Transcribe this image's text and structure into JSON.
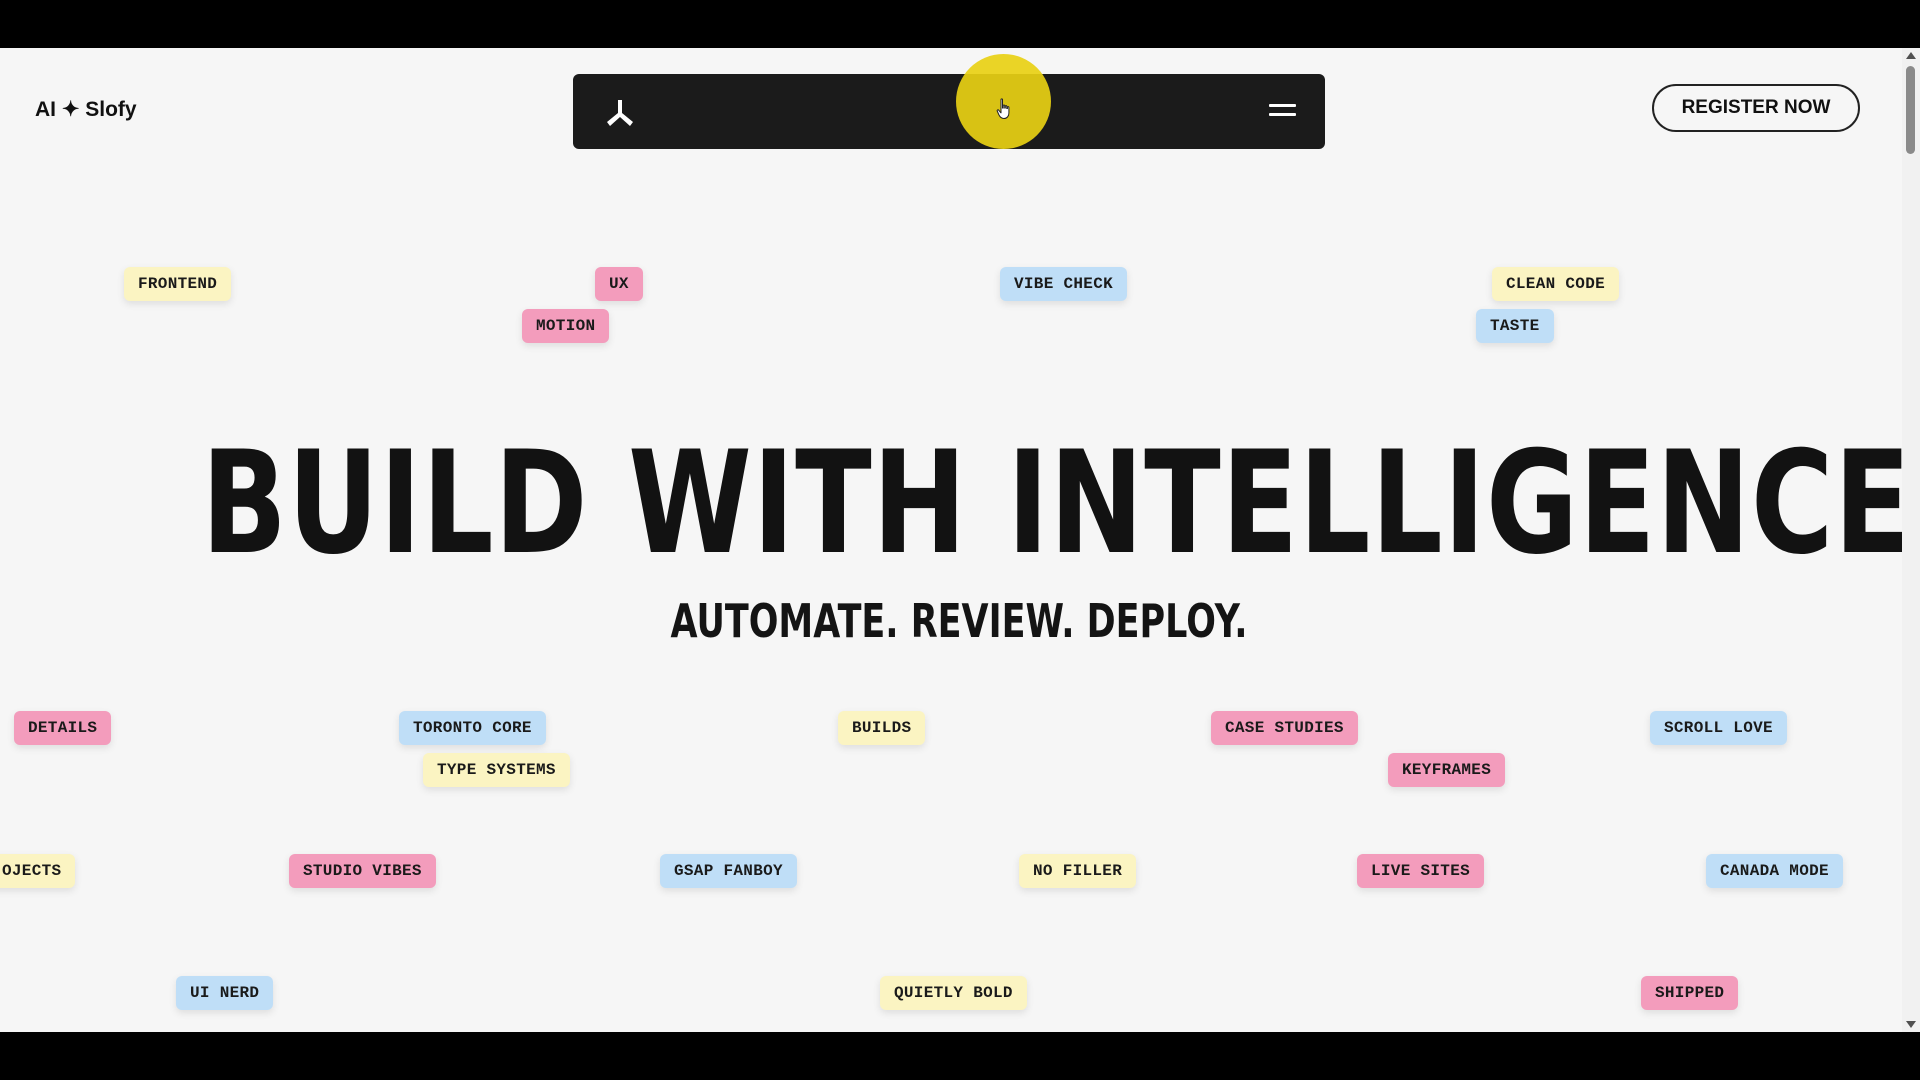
{
  "header": {
    "logo_text": "AI ✦ Slofy",
    "register_label": "REGISTER NOW"
  },
  "nav": {
    "logo_icon": "tri-blade-logo-icon",
    "menu_icon": "hamburger-menu-icon"
  },
  "hero": {
    "headline": "BUILD WITH INTELLIGENCE",
    "subheadline": "AUTOMATE. REVIEW. DEPLOY."
  },
  "tags": [
    {
      "label": "FRONTEND",
      "color": "yellow"
    },
    {
      "label": "UX",
      "color": "pink"
    },
    {
      "label": "MOTION",
      "color": "pink"
    },
    {
      "label": "VIBE CHECK",
      "color": "blue"
    },
    {
      "label": "CLEAN CODE",
      "color": "yellow"
    },
    {
      "label": "TASTE",
      "color": "blue"
    },
    {
      "label": "DETAILS",
      "color": "pink"
    },
    {
      "label": "TORONTO CORE",
      "color": "blue"
    },
    {
      "label": "TYPE SYSTEMS",
      "color": "yellow"
    },
    {
      "label": "BUILDS",
      "color": "yellow"
    },
    {
      "label": "CASE STUDIES",
      "color": "pink"
    },
    {
      "label": "KEYFRAMES",
      "color": "pink"
    },
    {
      "label": "SCROLL LOVE",
      "color": "blue"
    },
    {
      "label": "OJECTS",
      "color": "yellow"
    },
    {
      "label": "STUDIO VIBES",
      "color": "pink"
    },
    {
      "label": "GSAP FANBOY",
      "color": "blue"
    },
    {
      "label": "NO FILLER",
      "color": "yellow"
    },
    {
      "label": "LIVE SITES",
      "color": "pink"
    },
    {
      "label": "CANADA MODE",
      "color": "blue"
    },
    {
      "label": "UI NERD",
      "color": "blue"
    },
    {
      "label": "QUIETLY BOLD",
      "color": "yellow"
    },
    {
      "label": "SHIPPED",
      "color": "pink"
    }
  ],
  "colors": {
    "page_background": "#f6f6f6",
    "nav_background": "#1b1b1b",
    "cursor_highlight": "#e8d014",
    "tag_yellow": "#fbf4c2",
    "tag_pink": "#f39cbc",
    "tag_blue": "#bfdef7"
  }
}
